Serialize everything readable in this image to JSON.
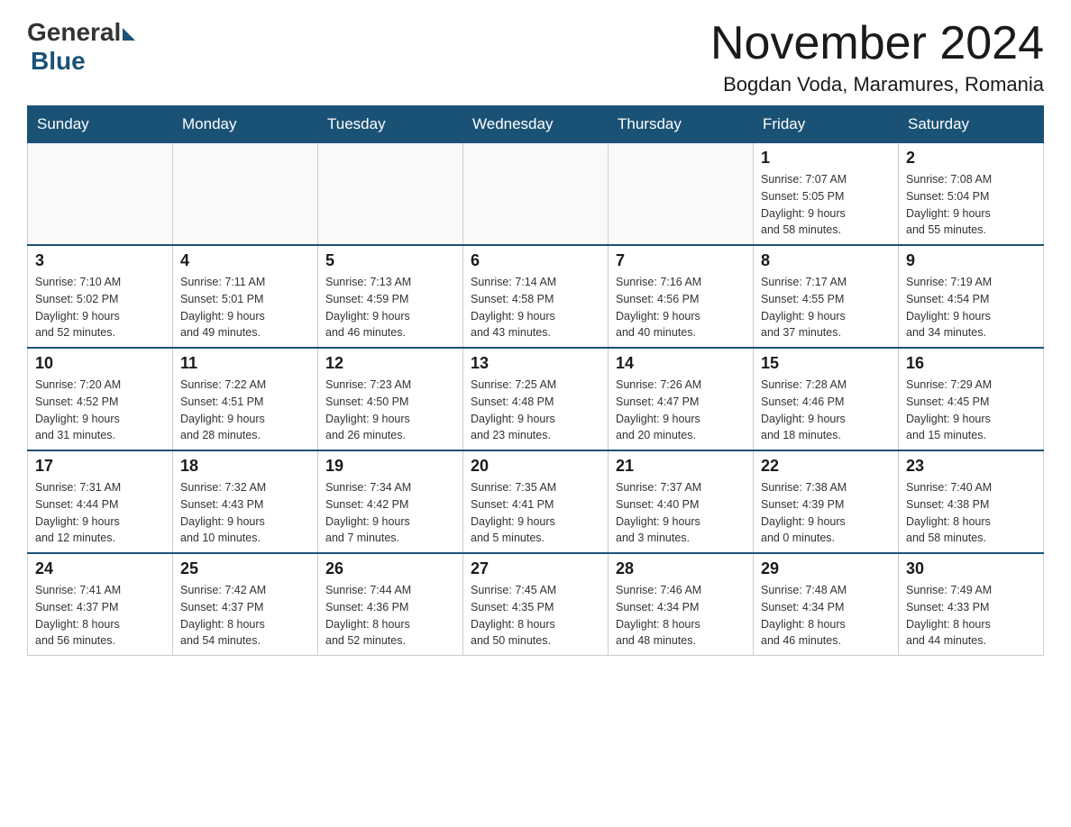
{
  "logo": {
    "general": "General",
    "blue": "Blue"
  },
  "title": "November 2024",
  "location": "Bogdan Voda, Maramures, Romania",
  "weekdays": [
    "Sunday",
    "Monday",
    "Tuesday",
    "Wednesday",
    "Thursday",
    "Friday",
    "Saturday"
  ],
  "weeks": [
    [
      {
        "day": "",
        "info": ""
      },
      {
        "day": "",
        "info": ""
      },
      {
        "day": "",
        "info": ""
      },
      {
        "day": "",
        "info": ""
      },
      {
        "day": "",
        "info": ""
      },
      {
        "day": "1",
        "info": "Sunrise: 7:07 AM\nSunset: 5:05 PM\nDaylight: 9 hours\nand 58 minutes."
      },
      {
        "day": "2",
        "info": "Sunrise: 7:08 AM\nSunset: 5:04 PM\nDaylight: 9 hours\nand 55 minutes."
      }
    ],
    [
      {
        "day": "3",
        "info": "Sunrise: 7:10 AM\nSunset: 5:02 PM\nDaylight: 9 hours\nand 52 minutes."
      },
      {
        "day": "4",
        "info": "Sunrise: 7:11 AM\nSunset: 5:01 PM\nDaylight: 9 hours\nand 49 minutes."
      },
      {
        "day": "5",
        "info": "Sunrise: 7:13 AM\nSunset: 4:59 PM\nDaylight: 9 hours\nand 46 minutes."
      },
      {
        "day": "6",
        "info": "Sunrise: 7:14 AM\nSunset: 4:58 PM\nDaylight: 9 hours\nand 43 minutes."
      },
      {
        "day": "7",
        "info": "Sunrise: 7:16 AM\nSunset: 4:56 PM\nDaylight: 9 hours\nand 40 minutes."
      },
      {
        "day": "8",
        "info": "Sunrise: 7:17 AM\nSunset: 4:55 PM\nDaylight: 9 hours\nand 37 minutes."
      },
      {
        "day": "9",
        "info": "Sunrise: 7:19 AM\nSunset: 4:54 PM\nDaylight: 9 hours\nand 34 minutes."
      }
    ],
    [
      {
        "day": "10",
        "info": "Sunrise: 7:20 AM\nSunset: 4:52 PM\nDaylight: 9 hours\nand 31 minutes."
      },
      {
        "day": "11",
        "info": "Sunrise: 7:22 AM\nSunset: 4:51 PM\nDaylight: 9 hours\nand 28 minutes."
      },
      {
        "day": "12",
        "info": "Sunrise: 7:23 AM\nSunset: 4:50 PM\nDaylight: 9 hours\nand 26 minutes."
      },
      {
        "day": "13",
        "info": "Sunrise: 7:25 AM\nSunset: 4:48 PM\nDaylight: 9 hours\nand 23 minutes."
      },
      {
        "day": "14",
        "info": "Sunrise: 7:26 AM\nSunset: 4:47 PM\nDaylight: 9 hours\nand 20 minutes."
      },
      {
        "day": "15",
        "info": "Sunrise: 7:28 AM\nSunset: 4:46 PM\nDaylight: 9 hours\nand 18 minutes."
      },
      {
        "day": "16",
        "info": "Sunrise: 7:29 AM\nSunset: 4:45 PM\nDaylight: 9 hours\nand 15 minutes."
      }
    ],
    [
      {
        "day": "17",
        "info": "Sunrise: 7:31 AM\nSunset: 4:44 PM\nDaylight: 9 hours\nand 12 minutes."
      },
      {
        "day": "18",
        "info": "Sunrise: 7:32 AM\nSunset: 4:43 PM\nDaylight: 9 hours\nand 10 minutes."
      },
      {
        "day": "19",
        "info": "Sunrise: 7:34 AM\nSunset: 4:42 PM\nDaylight: 9 hours\nand 7 minutes."
      },
      {
        "day": "20",
        "info": "Sunrise: 7:35 AM\nSunset: 4:41 PM\nDaylight: 9 hours\nand 5 minutes."
      },
      {
        "day": "21",
        "info": "Sunrise: 7:37 AM\nSunset: 4:40 PM\nDaylight: 9 hours\nand 3 minutes."
      },
      {
        "day": "22",
        "info": "Sunrise: 7:38 AM\nSunset: 4:39 PM\nDaylight: 9 hours\nand 0 minutes."
      },
      {
        "day": "23",
        "info": "Sunrise: 7:40 AM\nSunset: 4:38 PM\nDaylight: 8 hours\nand 58 minutes."
      }
    ],
    [
      {
        "day": "24",
        "info": "Sunrise: 7:41 AM\nSunset: 4:37 PM\nDaylight: 8 hours\nand 56 minutes."
      },
      {
        "day": "25",
        "info": "Sunrise: 7:42 AM\nSunset: 4:37 PM\nDaylight: 8 hours\nand 54 minutes."
      },
      {
        "day": "26",
        "info": "Sunrise: 7:44 AM\nSunset: 4:36 PM\nDaylight: 8 hours\nand 52 minutes."
      },
      {
        "day": "27",
        "info": "Sunrise: 7:45 AM\nSunset: 4:35 PM\nDaylight: 8 hours\nand 50 minutes."
      },
      {
        "day": "28",
        "info": "Sunrise: 7:46 AM\nSunset: 4:34 PM\nDaylight: 8 hours\nand 48 minutes."
      },
      {
        "day": "29",
        "info": "Sunrise: 7:48 AM\nSunset: 4:34 PM\nDaylight: 8 hours\nand 46 minutes."
      },
      {
        "day": "30",
        "info": "Sunrise: 7:49 AM\nSunset: 4:33 PM\nDaylight: 8 hours\nand 44 minutes."
      }
    ]
  ]
}
